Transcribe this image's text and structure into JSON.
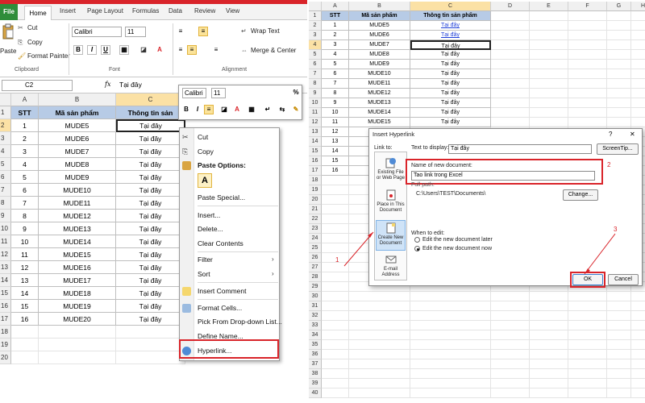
{
  "left": {
    "ribbon": {
      "tabs": [
        "File",
        "Home",
        "Insert",
        "Page Layout",
        "Formulas",
        "Data",
        "Review",
        "View"
      ],
      "clipboard": {
        "paste": "Paste",
        "cut": "Cut",
        "copy": "Copy",
        "format_painter": "Format Painter",
        "label": "Clipboard"
      },
      "font": {
        "name": "Calibri",
        "size": "11",
        "label": "Font",
        "bold": "B",
        "italic": "I",
        "underline": "U",
        "font_color_glyph": "A"
      },
      "alignment": {
        "wrap_text": "Wrap Text",
        "merge_center": "Merge & Center",
        "label": "Alignment"
      }
    },
    "formula_bar": {
      "cell_ref": "C2",
      "fx": "fx",
      "content": "Tại đây"
    },
    "columns": [
      "A",
      "B",
      "C"
    ],
    "rows": [
      "1",
      "2",
      "3",
      "4",
      "5",
      "6",
      "7",
      "8",
      "9",
      "10",
      "11",
      "12",
      "13",
      "14",
      "15",
      "16",
      "17",
      "18",
      "19",
      "20"
    ],
    "table": {
      "headers": [
        "STT",
        "Mã sản phẩm",
        "Thông tin sản"
      ],
      "data": [
        [
          "1",
          "MUDE5",
          "Tại đây"
        ],
        [
          "2",
          "MUDE6",
          "Tại đây"
        ],
        [
          "3",
          "MUDE7",
          "Tại đây"
        ],
        [
          "4",
          "MUDE8",
          "Tại đây"
        ],
        [
          "5",
          "MUDE9",
          "Tại đây"
        ],
        [
          "6",
          "MUDE10",
          "Tại đây"
        ],
        [
          "7",
          "MUDE11",
          "Tại đây"
        ],
        [
          "8",
          "MUDE12",
          "Tại đây"
        ],
        [
          "9",
          "MUDE13",
          "Tại đây"
        ],
        [
          "10",
          "MUDE14",
          "Tại đây"
        ],
        [
          "11",
          "MUDE15",
          "Tại đây"
        ],
        [
          "12",
          "MUDE16",
          "Tại đây"
        ],
        [
          "13",
          "MUDE17",
          "Tại đây"
        ],
        [
          "14",
          "MUDE18",
          "Tại đây"
        ],
        [
          "15",
          "MUDE19",
          "Tại đây"
        ],
        [
          "16",
          "MUDE20",
          "Tại đây"
        ]
      ]
    },
    "mini_toolbar": {
      "font": "Calibri",
      "size": "11",
      "bold": "B",
      "italic": "I"
    },
    "context_menu": {
      "items": [
        "Cut",
        "Copy",
        "Paste Options:",
        "Paste Special...",
        "Insert...",
        "Delete...",
        "Clear Contents",
        "Filter",
        "Sort",
        "Insert Comment",
        "Format Cells...",
        "Pick From Drop-down List...",
        "Define Name...",
        "Hyperlink..."
      ],
      "paste_glyph": "A"
    }
  },
  "right": {
    "columns": [
      "A",
      "B",
      "C",
      "D",
      "E",
      "F",
      "G",
      "H"
    ],
    "rows": [
      "1",
      "2",
      "3",
      "4",
      "5",
      "6",
      "7",
      "8",
      "9",
      "10",
      "11",
      "12",
      "13",
      "14",
      "15",
      "16",
      "17",
      "18",
      "19",
      "20",
      "21",
      "22",
      "23",
      "24",
      "25",
      "26",
      "27",
      "28",
      "29",
      "30",
      "31",
      "32",
      "33",
      "34",
      "35",
      "36",
      "37",
      "38",
      "39",
      "40"
    ],
    "table": {
      "headers": [
        "STT",
        "Mã sản phẩm",
        "Thông tin sản phẩm"
      ],
      "ids": [
        "1",
        "2",
        "3",
        "4",
        "5",
        "6",
        "7",
        "8",
        "9",
        "10",
        "11",
        "12",
        "13",
        "14",
        "15",
        "16"
      ],
      "products": [
        "MUDE5",
        "MUDE6",
        "MUDE7",
        "MUDE8",
        "MUDE9",
        "MUDE10",
        "MUDE11",
        "MUDE12",
        "MUDE13",
        "MUDE14",
        "MUDE15",
        "M",
        "M",
        "M",
        "M",
        "M"
      ],
      "links": [
        "Tại đây",
        "Tại đây",
        "Tại đây",
        "Tại đây",
        "Tại đây",
        "Tại đây",
        "Tại đây",
        "Tại đây",
        "Tại đây",
        "Tại đây",
        "Tại đây"
      ]
    },
    "dialog": {
      "title": "Insert Hyperlink",
      "help": "?",
      "close": "✕",
      "link_to": "Link to:",
      "text_to_display_label": "Text to display:",
      "text_to_display": "Tại đây",
      "screentip": "ScreenTip...",
      "link_items": [
        "Existing File or Web Page",
        "Place in This Document",
        "Create New Document",
        "E-mail Address"
      ],
      "name_label": "Name of new document:",
      "name_value": "Tao link trong Excel",
      "full_path_label": "Full path:",
      "full_path": "C:\\Users\\TEST\\Documents\\",
      "change": "Change...",
      "when_to_edit": "When to edit:",
      "edit_later": "Edit the new document later",
      "edit_now": "Edit the new document now",
      "ok": "OK",
      "cancel": "Cancel"
    },
    "annotations": [
      "1",
      "2",
      "3"
    ]
  },
  "colors": {
    "accent_red": "#d9242a",
    "header_fill": "#b7cbe6",
    "link_blue": "#1f3fd8",
    "file_tab": "#2f8d3a"
  }
}
